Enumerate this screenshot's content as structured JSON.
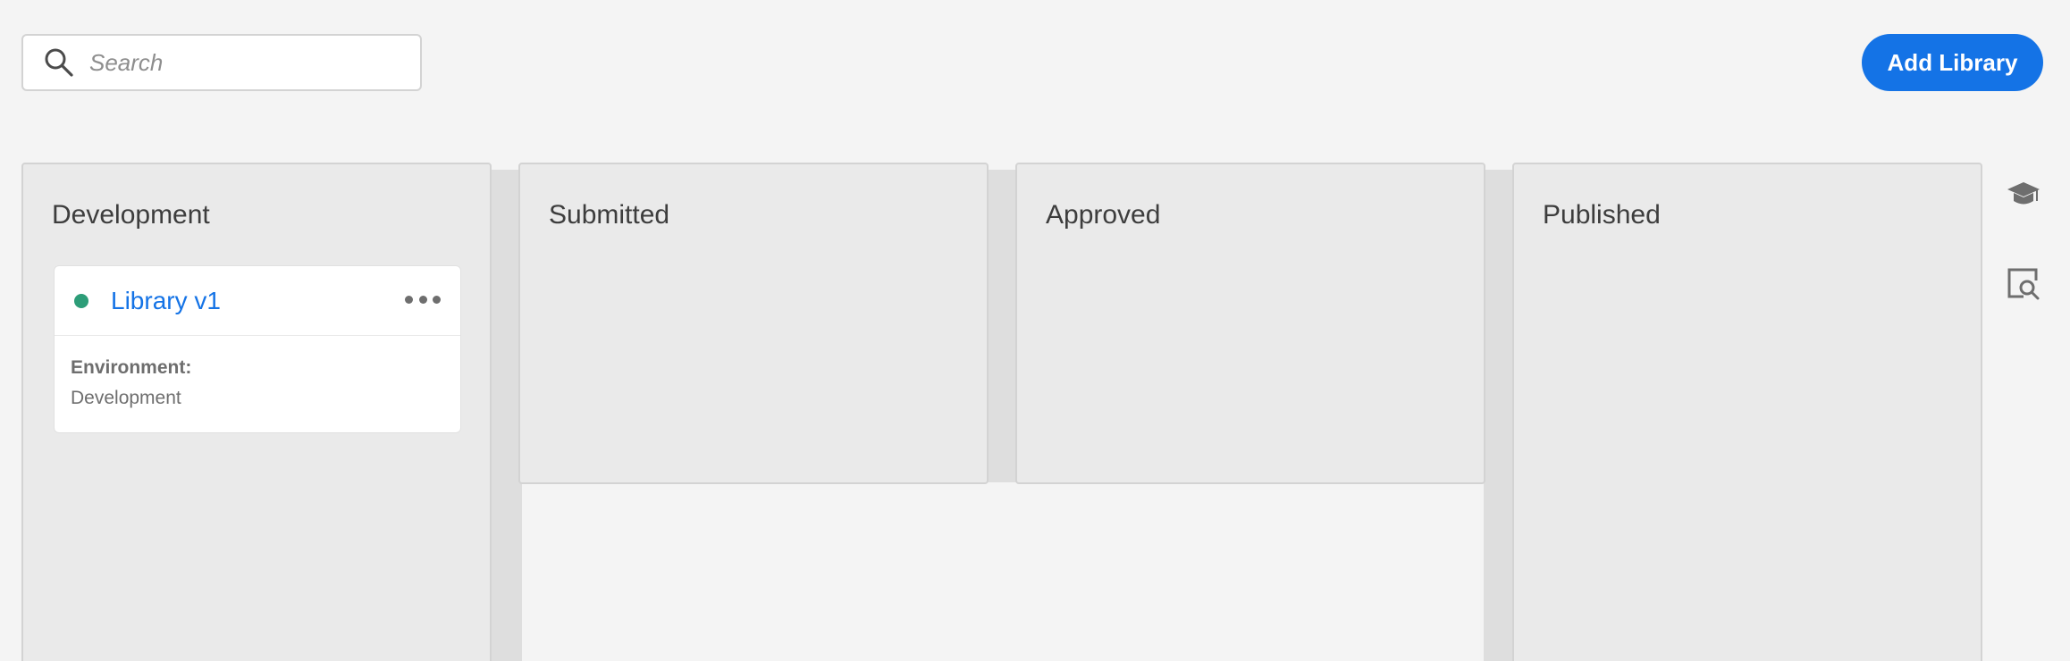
{
  "search": {
    "placeholder": "Search",
    "value": ""
  },
  "toolbar": {
    "add_library_label": "Add Library"
  },
  "columns": [
    {
      "title": "Development"
    },
    {
      "title": "Submitted"
    },
    {
      "title": "Approved"
    },
    {
      "title": "Published"
    }
  ],
  "library_card": {
    "title": "Library v1",
    "status_color": "#2d9d78",
    "environment_label": "Environment:",
    "environment_value": "Development"
  },
  "rail": {
    "icons": [
      "graduation-cap-icon",
      "preview-search-icon"
    ]
  },
  "colors": {
    "accent": "#1473e6",
    "status_green": "#2d9d78"
  }
}
